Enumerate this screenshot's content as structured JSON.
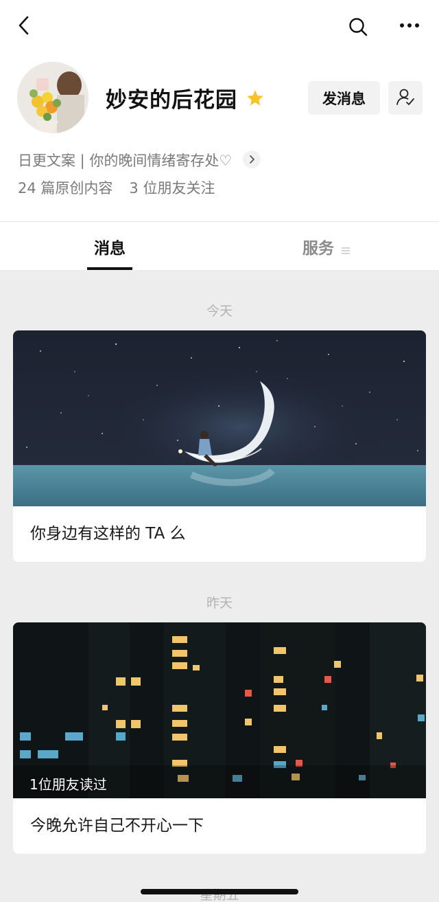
{
  "header": {
    "account_name": "妙安的后花园",
    "message_button": "发消息",
    "bio": "日更文案 | 你的晚间情绪寄存处♡",
    "stats": {
      "articles": "24 篇原创内容",
      "friends": "3 位朋友关注"
    }
  },
  "tabs": {
    "messages": "消息",
    "services": "服务"
  },
  "feed": {
    "groups": [
      {
        "date": "今天",
        "title": "你身边有这样的 TA 么"
      },
      {
        "date": "昨天",
        "read_badge": "1位朋友读过",
        "title": "今晚允许自己不开心一下"
      },
      {
        "date": "星期五"
      }
    ]
  },
  "icons": {
    "back": "back-arrow-icon",
    "search": "search-icon",
    "more": "more-dots-icon",
    "star": "star-icon",
    "follow": "user-follow-icon",
    "bio_more": "chevron-right-icon",
    "services_menu": "menu-lines-icon"
  },
  "colors": {
    "star": "#f8c32a",
    "feed_background": "#ededed",
    "muted_text": "#7a7a7a"
  }
}
